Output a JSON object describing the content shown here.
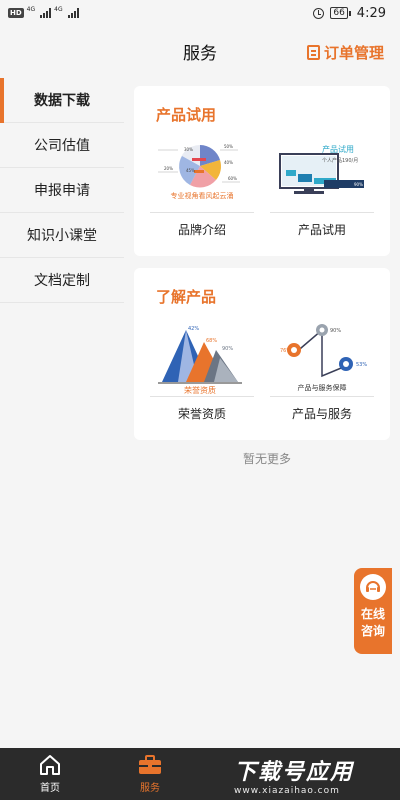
{
  "status_bar": {
    "hd": "HD",
    "net1": "4G",
    "net2": "4G",
    "battery": "66",
    "time": "4:29"
  },
  "header": {
    "title": "服务",
    "order_mgmt": "订单管理"
  },
  "sidebar": {
    "items": [
      {
        "label": "数据下载",
        "active": true
      },
      {
        "label": "公司估值",
        "active": false
      },
      {
        "label": "申报申请",
        "active": false
      },
      {
        "label": "知识小课堂",
        "active": false
      },
      {
        "label": "文档定制",
        "active": false
      }
    ]
  },
  "cards": [
    {
      "title": "产品试用",
      "tiles": [
        {
          "label": "品牌介绍",
          "img_caption": "专业视角看风起云涌",
          "img_values": [
            "30%",
            "50%",
            "20%",
            "45%",
            "40%",
            "60%"
          ]
        },
        {
          "label": "产品试用",
          "img_caption": "产品试用",
          "img_sub": "个人产品190/月",
          "img_value": "90%"
        }
      ]
    },
    {
      "title": "了解产品",
      "tiles": [
        {
          "label": "荣誉资质",
          "img_caption": "荣誉资质",
          "img_values": [
            "42%",
            "68%",
            "90%"
          ]
        },
        {
          "label": "产品与服务",
          "img_caption": "产品与服务保障",
          "img_values": [
            "76%",
            "90%",
            "53%"
          ]
        }
      ]
    }
  ],
  "no_more": "暂无更多",
  "consult": {
    "label": "在线咨询"
  },
  "bottom_nav": {
    "items": [
      {
        "label": "首页",
        "icon": "home-icon",
        "active": false
      },
      {
        "label": "服务",
        "icon": "briefcase-icon",
        "active": true
      }
    ]
  },
  "watermark": {
    "big": "下载号应用",
    "small": "www.xiazaihao.com"
  },
  "colors": {
    "accent": "#e8742c",
    "nav_bg": "#2b2b2b",
    "bg": "#f5f5f5"
  }
}
